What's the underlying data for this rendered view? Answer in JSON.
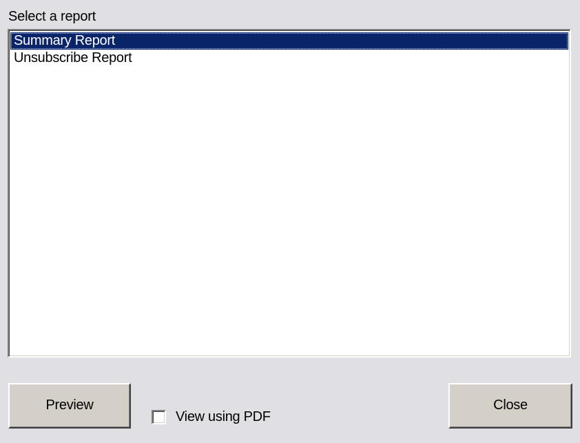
{
  "dialog": {
    "prompt": "Select a report"
  },
  "report_list": {
    "items": [
      {
        "label": "Summary Report",
        "selected": true
      },
      {
        "label": "Unsubscribe Report",
        "selected": false
      }
    ],
    "selection_color": "#0a246a"
  },
  "footer": {
    "preview_label": "Preview",
    "view_pdf_label": "View using PDF",
    "view_pdf_checked": false,
    "close_label": "Close"
  }
}
